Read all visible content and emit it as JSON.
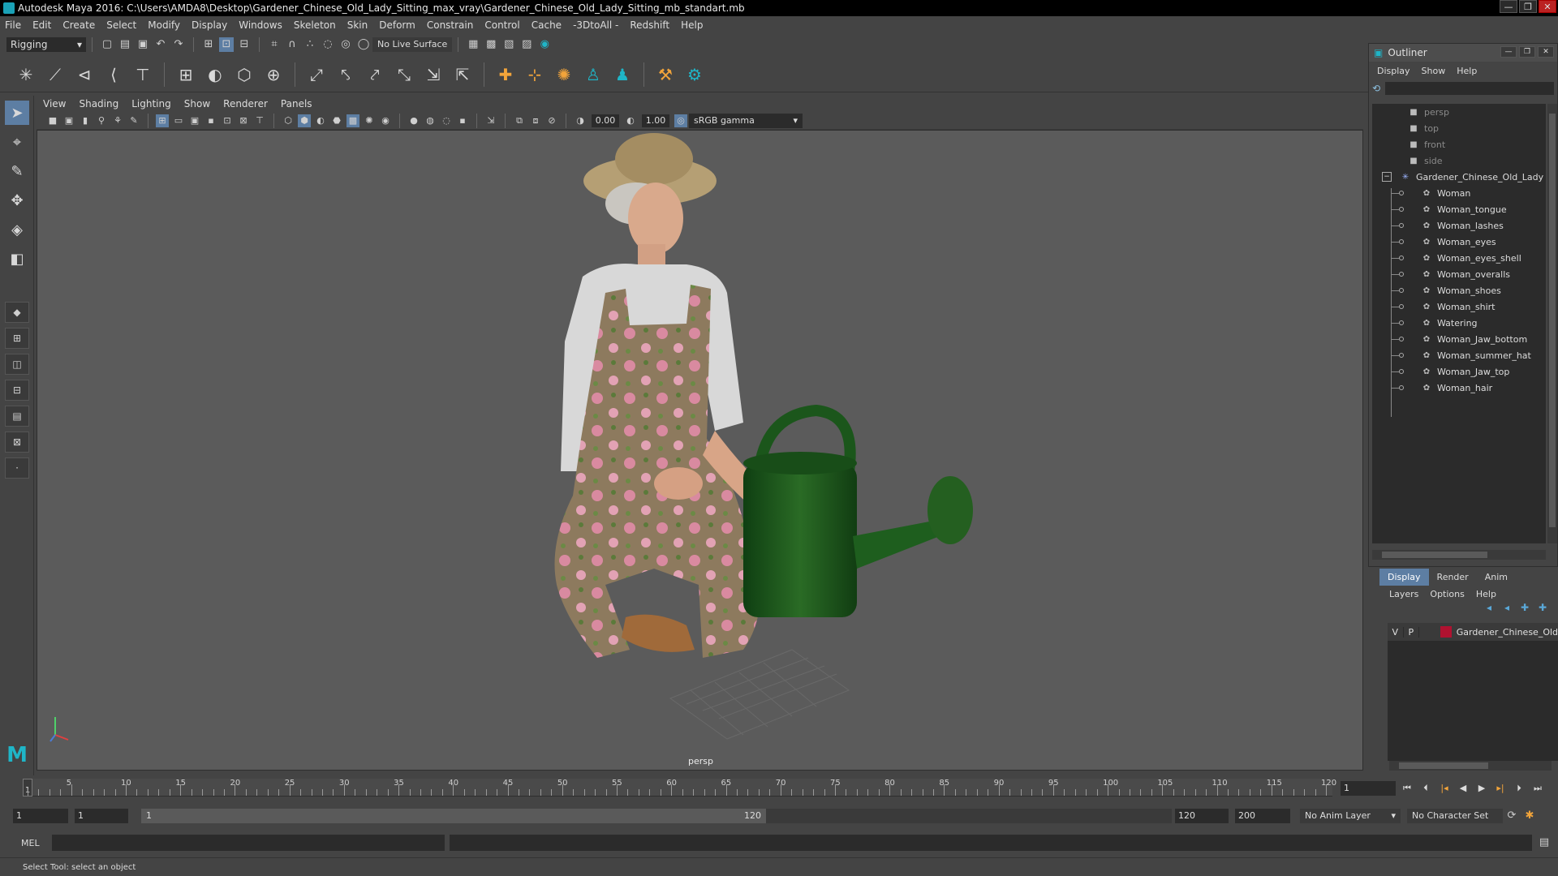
{
  "window": {
    "title": "Autodesk Maya 2016: C:\\Users\\AMDA8\\Desktop\\Gardener_Chinese_Old_Lady_Sitting_max_vray\\Gardener_Chinese_Old_Lady_Sitting_mb_standart.mb"
  },
  "menubar": [
    "File",
    "Edit",
    "Create",
    "Select",
    "Modify",
    "Display",
    "Windows",
    "Skeleton",
    "Skin",
    "Deform",
    "Constrain",
    "Control",
    "Cache",
    "-3DtoAll -",
    "Redshift",
    "Help"
  ],
  "statusline": {
    "menu_set": "Rigging",
    "live_surface": "No Live Surface"
  },
  "viewport": {
    "menu": [
      "View",
      "Shading",
      "Lighting",
      "Show",
      "Renderer",
      "Panels"
    ],
    "near_value": "0.00",
    "far_value": "1.00",
    "color_space": "sRGB gamma",
    "camera_label": "persp"
  },
  "outliner": {
    "title": "Outliner",
    "menu": [
      "Display",
      "Show",
      "Help"
    ],
    "cameras": [
      "persp",
      "top",
      "front",
      "side"
    ],
    "group": "Gardener_Chinese_Old_Lady",
    "children": [
      "Woman",
      "Woman_tongue",
      "Woman_lashes",
      "Woman_eyes",
      "Woman_eyes_shell",
      "Woman_overalls",
      "Woman_shoes",
      "Woman_shirt",
      "Watering",
      "Woman_Jaw_bottom",
      "Woman_summer_hat",
      "Woman_Jaw_top",
      "Woman_hair"
    ]
  },
  "layer_editor": {
    "tabs": [
      "Display",
      "Render",
      "Anim"
    ],
    "active_tab": "Display",
    "menu": [
      "Layers",
      "Options",
      "Help"
    ],
    "layer": {
      "v": "V",
      "p": "P",
      "name": "Gardener_Chinese_Old",
      "color": "#b01230"
    }
  },
  "timeline": {
    "ticks": [
      5,
      10,
      15,
      20,
      25,
      30,
      35,
      40,
      45,
      50,
      55,
      60,
      65,
      70,
      75,
      80,
      85,
      90,
      95,
      100,
      105,
      110,
      115,
      120
    ],
    "start_frame": "1",
    "current_frame": "1",
    "max_frame": 120
  },
  "range": {
    "anim_start": "1",
    "playback_start": "1",
    "range_start_label": "1",
    "range_end_label": "120",
    "playback_end": "120",
    "anim_end": "200",
    "anim_layer": "No Anim Layer",
    "character_set": "No Character Set"
  },
  "command_line": {
    "label": "MEL"
  },
  "help_line": "Select Tool: select an object"
}
